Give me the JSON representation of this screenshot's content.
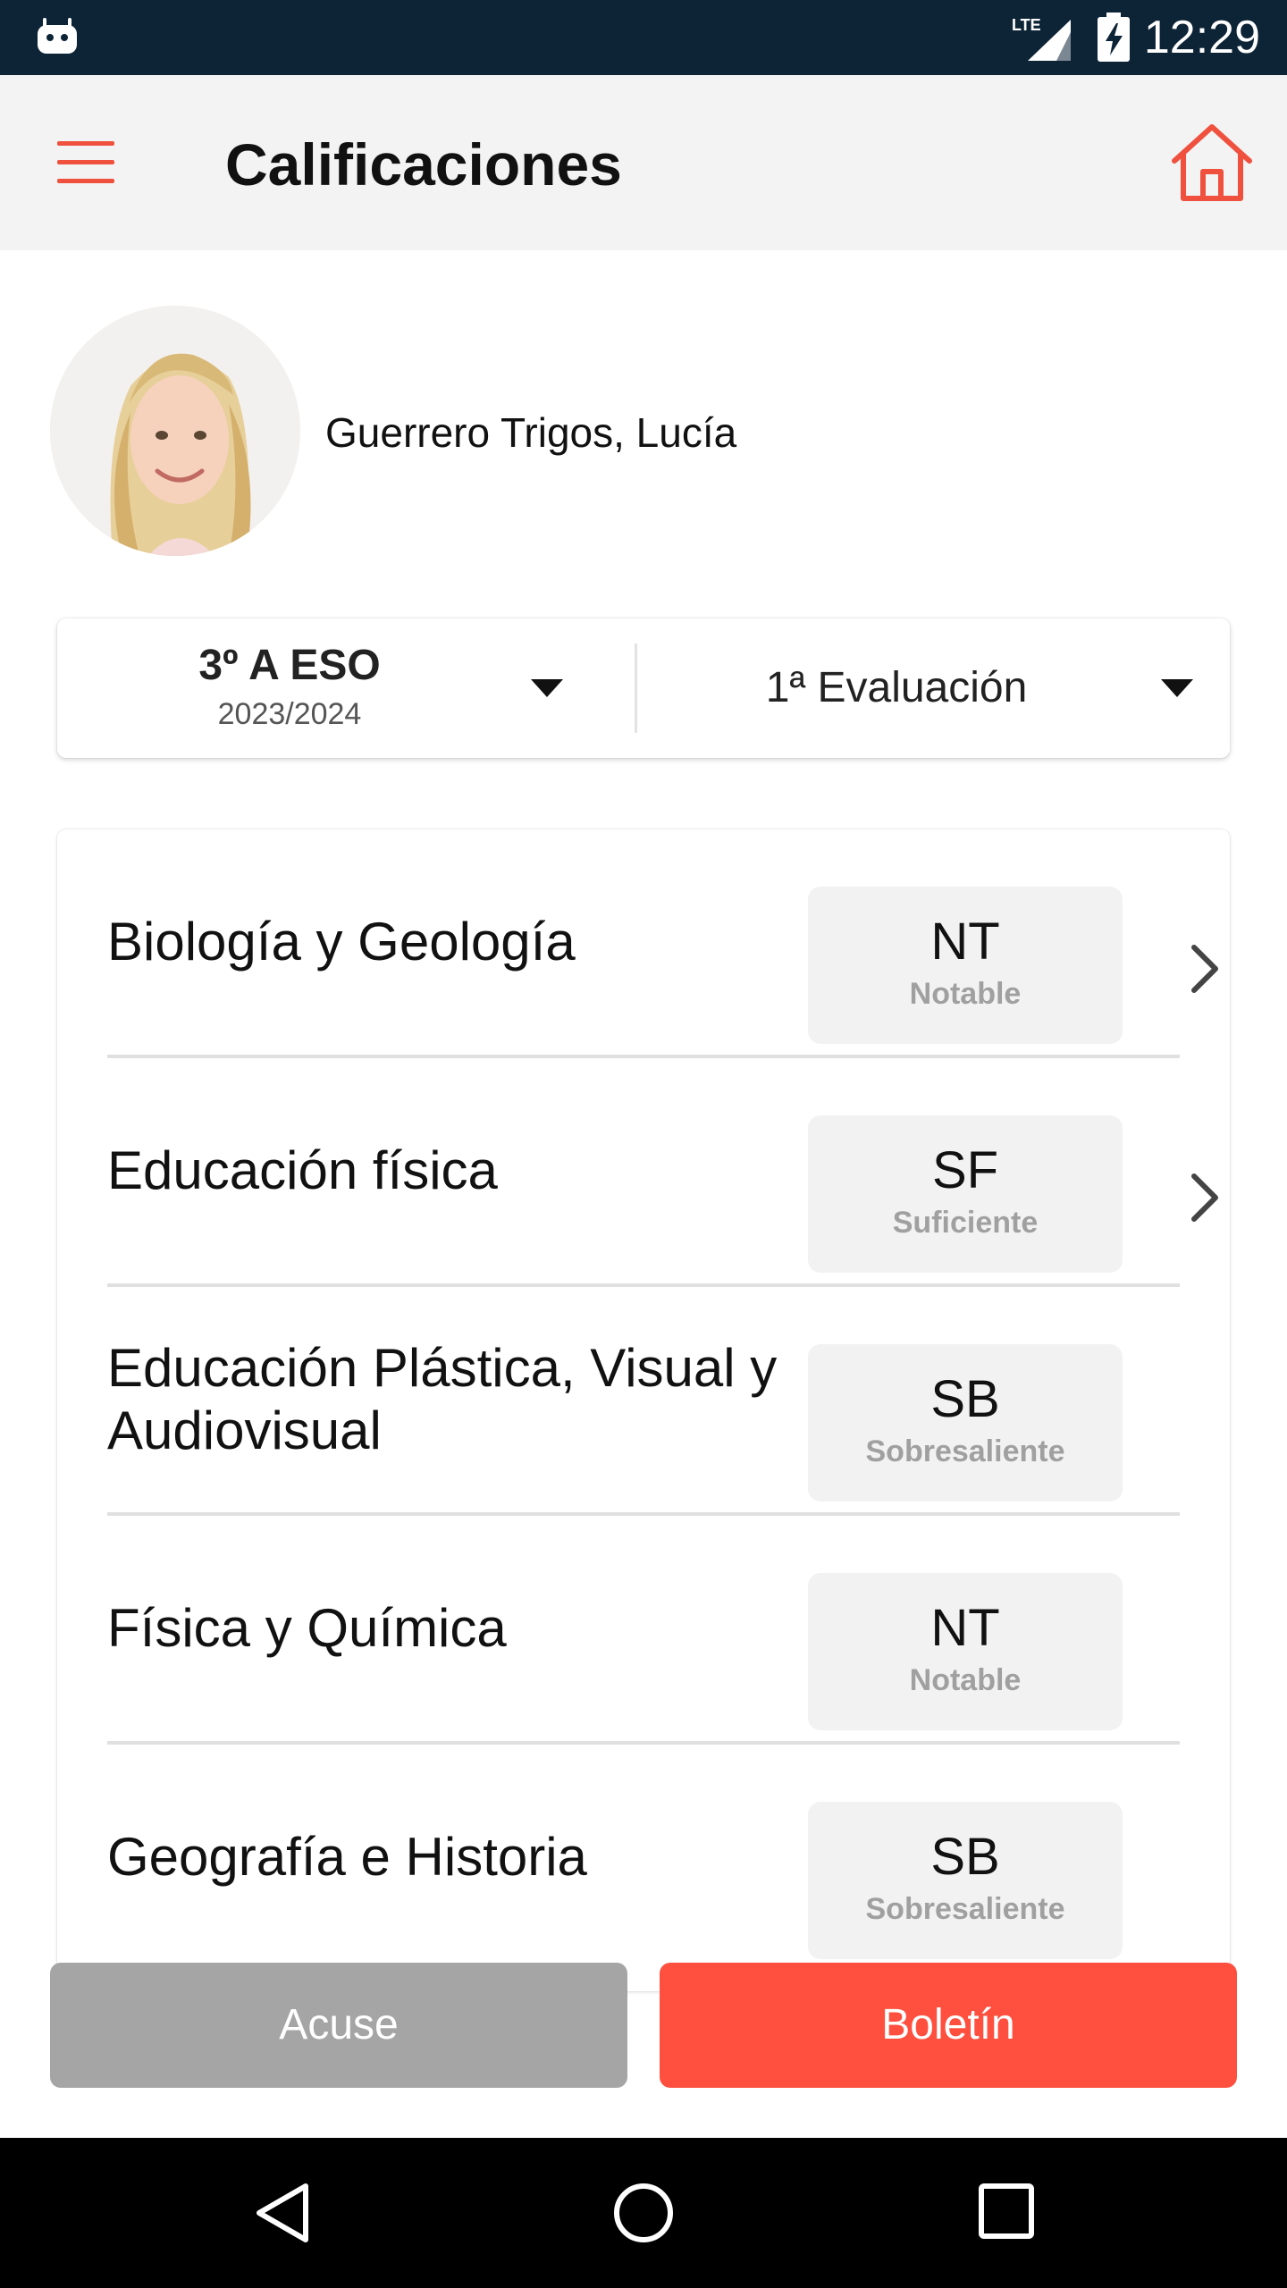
{
  "status_bar": {
    "time": "12:29",
    "network": "LTE",
    "icons": [
      "android-icon",
      "lte-signal-icon",
      "battery-charging-icon"
    ]
  },
  "header": {
    "title": "Calificaciones",
    "icons": [
      "menu-icon",
      "home-icon"
    ],
    "accent_color": "#f0503e"
  },
  "student": {
    "name": "Guerrero Trigos, Lucía"
  },
  "selectors": {
    "course": "3º A ESO",
    "year": "2023/2024",
    "evaluation": "1ª Evaluación"
  },
  "grades": [
    {
      "subject": "Biología y Geología",
      "abbr": "NT",
      "label": "Notable",
      "has_detail": true
    },
    {
      "subject": "Educación física",
      "abbr": "SF",
      "label": "Suficiente",
      "has_detail": true
    },
    {
      "subject": "Educación Plástica, Visual y Audiovisual",
      "abbr": "SB",
      "label": "Sobresaliente",
      "has_detail": false
    },
    {
      "subject": "Física y Química",
      "abbr": "NT",
      "label": "Notable",
      "has_detail": false
    },
    {
      "subject": "Geografía e Historia",
      "abbr": "SB",
      "label": "Sobresaliente",
      "has_detail": false
    }
  ],
  "actions": {
    "acuse_label": "Acuse",
    "boletin_label": "Boletín",
    "acuse_color": "#a5a5a5",
    "boletin_color": "#ff4f3f"
  },
  "nav_bar": {
    "icons": [
      "back-icon",
      "home-circle-icon",
      "recent-apps-icon"
    ]
  }
}
